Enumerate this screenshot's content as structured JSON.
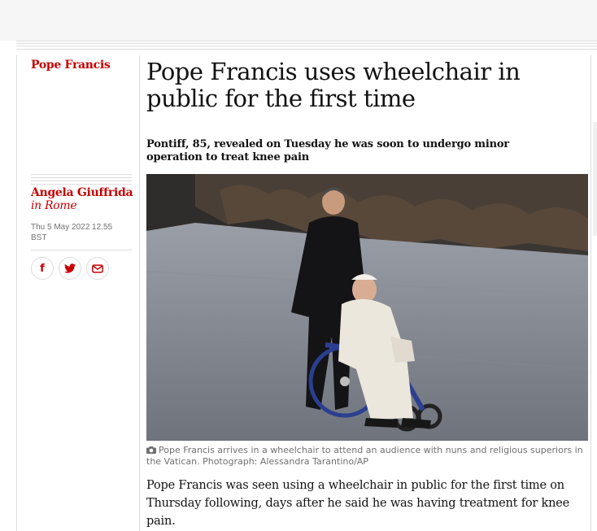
{
  "article": {
    "section": "Pope Francis",
    "headline": "Pope Francis uses wheelchair in public for the first time",
    "standfirst": "Pontiff, 85, revealed on Tuesday he was soon to undergo minor operation to treat knee pain",
    "author": "Angela Giuffrida",
    "location": "in Rome",
    "dateline": "Thu 5 May 2022 12.55 BST",
    "caption": "Pope Francis arrives in a wheelchair to attend an audience with nuns and religious superiors in the Vatican. Photograph: Alessandra Tarantino/AP",
    "body": "Pope Francis was seen using a wheelchair in public for the first time on Thursday following, days after he said he was having treatment for knee pain."
  },
  "share": {
    "facebook": "f",
    "twitter_icon": "twitter-icon",
    "email_icon": "email-icon"
  },
  "colors": {
    "accent": "#c70000",
    "text": "#121212",
    "muted": "#707070",
    "rule": "#dcdcdc"
  }
}
